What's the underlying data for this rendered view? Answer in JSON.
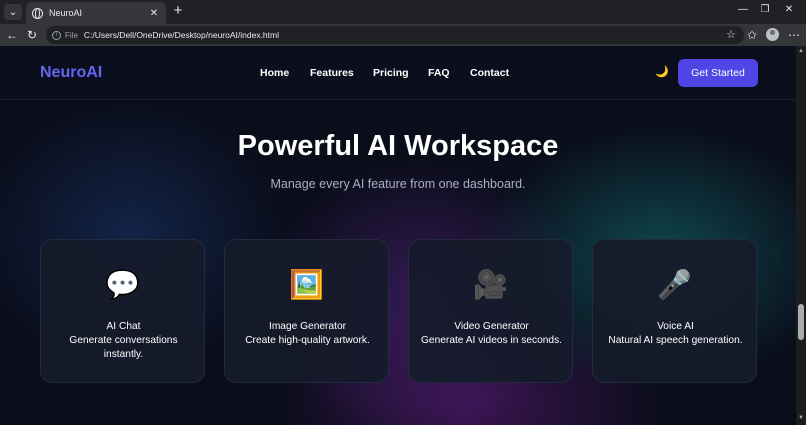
{
  "browser": {
    "tab_title": "NeuroAI",
    "url_scheme": "File",
    "url": "C:/Users/Dell/OneDrive/Desktop/neuroAI/index.html"
  },
  "nav": {
    "logo": "NeuroAI",
    "links": [
      "Home",
      "Features",
      "Pricing",
      "FAQ",
      "Contact"
    ],
    "cta": "Get Started"
  },
  "hero": {
    "title": "Powerful AI Workspace",
    "subtitle": "Manage every AI feature from one dashboard."
  },
  "features": [
    {
      "icon": "💬",
      "icon_name": "speech-bubble-icon",
      "title": "AI Chat",
      "description": "Generate conversations instantly."
    },
    {
      "icon": "🖼️",
      "icon_name": "framed-picture-icon",
      "title": "Image Generator",
      "description": "Create high-quality artwork."
    },
    {
      "icon": "🎥",
      "icon_name": "movie-camera-icon",
      "title": "Video Generator",
      "description": "Generate AI videos in seconds."
    },
    {
      "icon": "🎤",
      "icon_name": "microphone-icon",
      "title": "Voice AI",
      "description": "Natural AI speech generation."
    }
  ],
  "colors": {
    "brand": "#6366f1",
    "cta": "#4f46e5",
    "background": "#0a0d1a"
  }
}
